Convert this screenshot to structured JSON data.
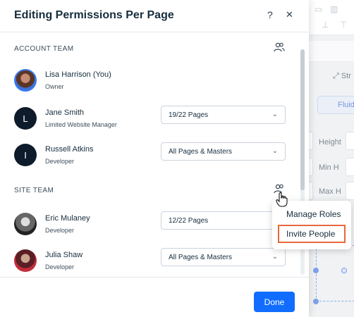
{
  "modal": {
    "title": "Editing Permissions Per Page",
    "help_icon": "?",
    "close_icon": "✕",
    "done_label": "Done"
  },
  "account_team": {
    "label": "ACCOUNT TEAM",
    "members": [
      {
        "name": "Lisa Harrison (You)",
        "role": "Owner",
        "avatar": "photo",
        "access": ""
      },
      {
        "name": "Jane Smith",
        "role": "Limited Website Manager",
        "avatar": "L",
        "access": "19/22 Pages"
      },
      {
        "name": "Russell Atkins",
        "role": "Developer",
        "avatar": "I",
        "access": "All Pages & Masters"
      }
    ]
  },
  "site_team": {
    "label": "SITE TEAM",
    "members": [
      {
        "name": "Eric Mulaney",
        "role": "Developer",
        "avatar": "photo",
        "access": "12/22 Pages"
      },
      {
        "name": "Julia Shaw",
        "role": "Developer",
        "avatar": "photo",
        "access": "All Pages & Masters"
      }
    ]
  },
  "menu": {
    "items": [
      "Manage Roles",
      "Invite People"
    ],
    "highlighted": "Invite People"
  },
  "background_editor": {
    "labels": [
      "Str",
      "Fluid",
      "Height",
      "Min H",
      "Max H"
    ]
  },
  "colors": {
    "primary": "#116dff",
    "highlight": "#e8673f"
  }
}
